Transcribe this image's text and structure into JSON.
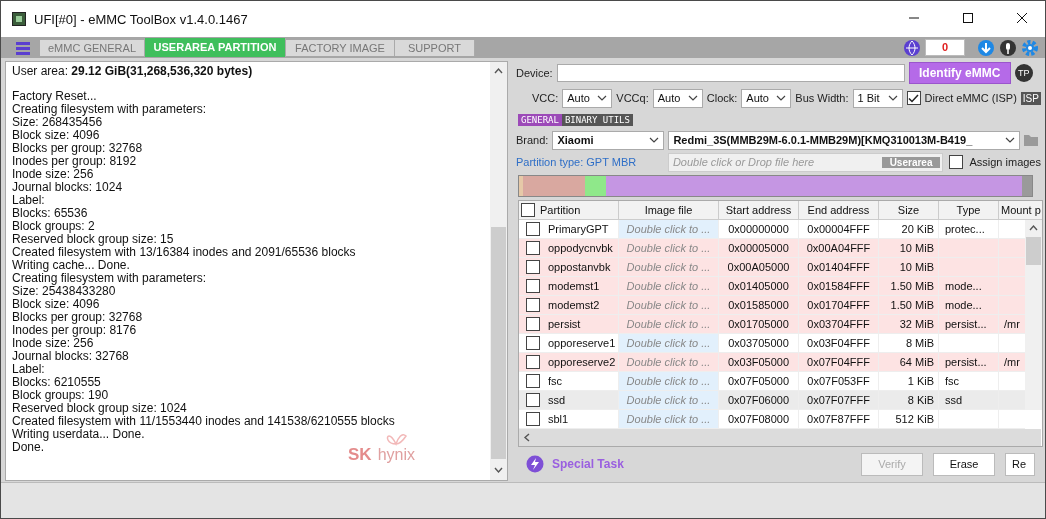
{
  "window": {
    "title": "UFI[#0] - eMMC ToolBox v1.4.0.1467"
  },
  "tabs": [
    {
      "label": "eMMC GENERAL",
      "selected": false
    },
    {
      "label": "USERAREA PARTITION",
      "selected": true
    },
    {
      "label": "FACTORY IMAGE",
      "selected": false
    },
    {
      "label": "SUPPORT",
      "selected": false
    }
  ],
  "toolbar": {
    "counter": "0"
  },
  "log": {
    "summary_label": "User area:",
    "summary_value": "29.12 GiB(31,268,536,320 bytes)",
    "lines": [
      "Factory Reset...",
      "Creating filesystem with parameters:",
      "Size: 268435456",
      "Block size: 4096",
      "Blocks per group: 32768",
      "Inodes per group: 8192",
      "Inode size: 256",
      "Journal blocks: 1024",
      "Label:",
      "Blocks: 65536",
      "Block groups: 2",
      "Reserved block group size: 15",
      "Created filesystem with 13/16384 inodes and 2091/65536 blocks",
      "Writing cache... Done.",
      "Creating filesystem with parameters:",
      "Size: 25438433280",
      "Block size: 4096",
      "Blocks per group: 32768",
      "Inodes per group: 8176",
      "Inode size: 256",
      "Journal blocks: 32768",
      "Label:",
      "Blocks: 6210555",
      "Block groups: 190",
      "Reserved block group size: 1024",
      "Created filesystem with 11/1553440 inodes and 141538/6210555 blocks",
      "Writing userdata... Done.",
      "Done."
    ],
    "vendor_logo": [
      "SK",
      "hynix"
    ]
  },
  "device": {
    "label": "Device:",
    "button": "Identify eMMC",
    "badge": "TP"
  },
  "settings": [
    {
      "label": "VCC:",
      "value": "Auto"
    },
    {
      "label": "VCCq:",
      "value": "Auto"
    },
    {
      "label": "Clock:",
      "value": "Auto"
    },
    {
      "label": "Bus Width:",
      "value": "1 Bit"
    }
  ],
  "direct_isp": {
    "label": "Direct eMMC (ISP)",
    "checked": true,
    "badge": "ISP"
  },
  "subtabs": [
    {
      "label": "GENERAL",
      "selected": true
    },
    {
      "label": "BINARY UTILS",
      "selected": false
    }
  ],
  "brand": {
    "label": "Brand:",
    "value": "Xiaomi"
  },
  "model": {
    "value": "Redmi_3S(MMB29M-6.0.1-MMB29M)[KMQ310013M-B419_"
  },
  "partition_type": "Partition type: GPT MBR",
  "file_drop": {
    "placeholder": "Double click or Drop file here",
    "badge": "Userarea"
  },
  "assign_images": {
    "label": "Assign images",
    "checked": false
  },
  "table": {
    "all_checked": false,
    "columns": [
      "Partition",
      "Image file",
      "Start address",
      "End address",
      "Size",
      "Type",
      "Mount p"
    ],
    "rows": [
      {
        "checked": false,
        "highlighted": false,
        "selected": false,
        "cells": [
          "PrimaryGPT",
          "Double click to ...",
          "0x00000000",
          "0x00004FFF",
          "20 KiB",
          "protec...",
          ""
        ]
      },
      {
        "checked": false,
        "highlighted": true,
        "selected": false,
        "cells": [
          "oppodycnvbk",
          "Double click to ...",
          "0x00005000",
          "0x00A04FFF",
          "10 MiB",
          "",
          ""
        ]
      },
      {
        "checked": false,
        "highlighted": true,
        "selected": false,
        "cells": [
          "oppostanvbk",
          "Double click to ...",
          "0x00A05000",
          "0x01404FFF",
          "10 MiB",
          "",
          ""
        ]
      },
      {
        "checked": false,
        "highlighted": true,
        "selected": false,
        "cells": [
          "modemst1",
          "Double click to ...",
          "0x01405000",
          "0x01584FFF",
          "1.50 MiB",
          "mode...",
          ""
        ]
      },
      {
        "checked": false,
        "highlighted": true,
        "selected": false,
        "cells": [
          "modemst2",
          "Double click to ...",
          "0x01585000",
          "0x01704FFF",
          "1.50 MiB",
          "mode...",
          ""
        ]
      },
      {
        "checked": false,
        "highlighted": true,
        "selected": false,
        "cells": [
          "persist",
          "Double click to ...",
          "0x01705000",
          "0x03704FFF",
          "32 MiB",
          "persist...",
          "/mr"
        ]
      },
      {
        "checked": false,
        "highlighted": false,
        "selected": false,
        "cells": [
          "opporeserve1",
          "Double click to ...",
          "0x03705000",
          "0x03F04FFF",
          "8 MiB",
          "",
          ""
        ]
      },
      {
        "checked": false,
        "highlighted": true,
        "selected": false,
        "cells": [
          "opporeserve2",
          "Double click to ...",
          "0x03F05000",
          "0x07F04FFF",
          "64 MiB",
          "persist...",
          "/mr"
        ]
      },
      {
        "checked": false,
        "highlighted": false,
        "selected": false,
        "cells": [
          "fsc",
          "Double click to ...",
          "0x07F05000",
          "0x07F053FF",
          "1 KiB",
          "fsc",
          ""
        ]
      },
      {
        "checked": false,
        "highlighted": false,
        "selected": true,
        "cells": [
          "ssd",
          "Double click to ...",
          "0x07F06000",
          "0x07F07FFF",
          "8 KiB",
          "ssd",
          ""
        ]
      },
      {
        "checked": false,
        "highlighted": false,
        "selected": false,
        "cells": [
          "sbl1",
          "Double click to ...",
          "0x07F08000",
          "0x07F87FFF",
          "512 KiB",
          "",
          ""
        ]
      }
    ]
  },
  "special_task": "Special Task",
  "buttons": [
    {
      "label": "Verify",
      "disabled": true
    },
    {
      "label": "Erase",
      "disabled": false
    },
    {
      "label": "Re",
      "disabled": false
    }
  ]
}
